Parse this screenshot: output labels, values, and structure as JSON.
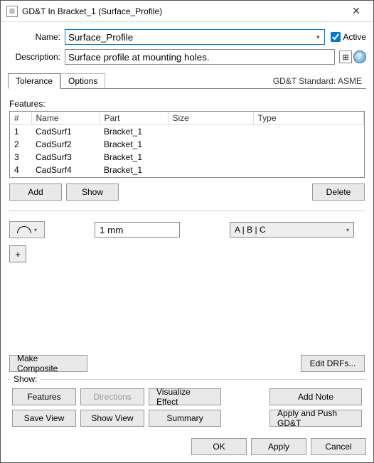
{
  "window": {
    "title": "GD&T In Bracket_1 (Surface_Profile)"
  },
  "header": {
    "name_label": "Name:",
    "name_value": "Surface_Profile",
    "active_label": "Active",
    "active_checked": true,
    "description_label": "Description:",
    "description_value": "Surface profile at mounting holes."
  },
  "tabs": {
    "tolerance": "Tolerance",
    "options": "Options",
    "standard": "GD&T Standard: ASME"
  },
  "features": {
    "section_label": "Features:",
    "columns": {
      "idx": "#",
      "name": "Name",
      "part": "Part",
      "size": "Size",
      "type": "Type"
    },
    "rows": [
      {
        "idx": "1",
        "name": "CadSurf1",
        "part": "Bracket_1",
        "size": "",
        "type": ""
      },
      {
        "idx": "2",
        "name": "CadSurf2",
        "part": "Bracket_1",
        "size": "",
        "type": ""
      },
      {
        "idx": "3",
        "name": "CadSurf3",
        "part": "Bracket_1",
        "size": "",
        "type": ""
      },
      {
        "idx": "4",
        "name": "CadSurf4",
        "part": "Bracket_1",
        "size": "",
        "type": ""
      }
    ],
    "buttons": {
      "add": "Add",
      "show": "Show",
      "delete": "Delete"
    }
  },
  "tolerance_row": {
    "value": "1 mm",
    "drf": "A | B | C"
  },
  "composite": {
    "make": "Make Composite",
    "edit_drfs": "Edit DRFs..."
  },
  "show": {
    "legend": "Show:",
    "features": "Features",
    "directions": "Directions",
    "visualize": "Visualize Effect",
    "add_note": "Add Note",
    "save_view": "Save View",
    "show_view": "Show View",
    "summary": "Summary",
    "apply_push": "Apply and Push GD&T"
  },
  "dialog_buttons": {
    "ok": "OK",
    "apply": "Apply",
    "cancel": "Cancel"
  },
  "icons": {
    "app": "▦",
    "grid": "⊞",
    "help": "?"
  }
}
